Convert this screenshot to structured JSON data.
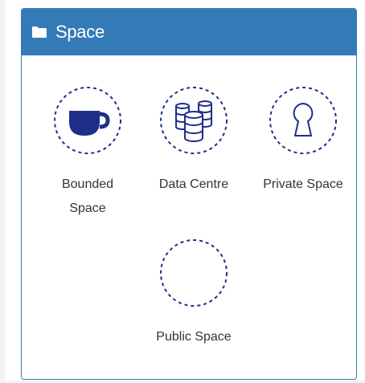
{
  "panel": {
    "title": "Space",
    "header_icon": "folder-icon",
    "accent_color": "#337ab7",
    "circle_color": "#1e2f8a"
  },
  "tiles": [
    {
      "label": "Bounded Space",
      "icon": "cup-icon"
    },
    {
      "label": "Data Centre",
      "icon": "database-icon"
    },
    {
      "label": "Private Space",
      "icon": "keyhole-icon"
    },
    {
      "label": "Public Space",
      "icon": ""
    }
  ]
}
